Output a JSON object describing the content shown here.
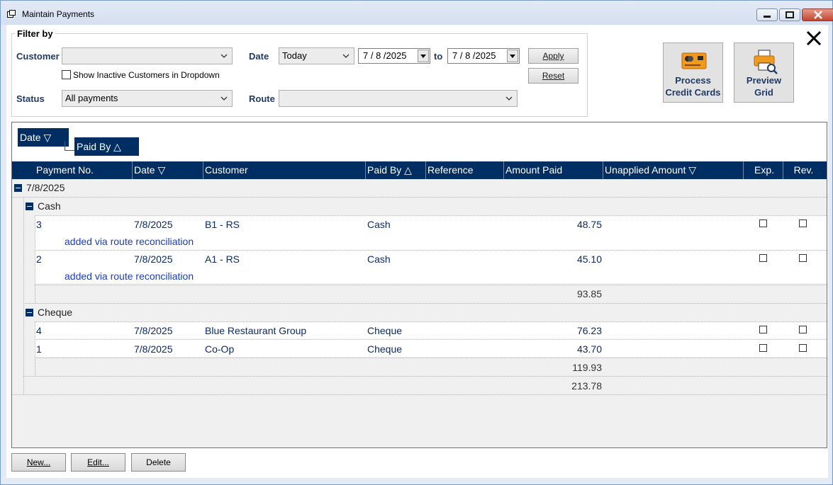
{
  "window": {
    "title": "Maintain Payments"
  },
  "filter": {
    "title": "Filter by",
    "customer_label": "Customer",
    "customer_value": "",
    "show_inactive_label": "Show Inactive Customers in Dropdown",
    "status_label": "Status",
    "status_value": "All payments",
    "date_label": "Date",
    "date_preset": "Today",
    "date_from": "7 / 8 /2025",
    "to_label": "to",
    "date_to": "7 / 8 /2025",
    "route_label": "Route",
    "route_value": "",
    "apply_label": "Apply",
    "reset_label": "Reset"
  },
  "actions": {
    "process_cc_line1": "Process",
    "process_cc_line2": "Credit Cards",
    "preview_line1": "Preview",
    "preview_line2": "Grid"
  },
  "group_by": {
    "chip1": "Date ▽",
    "chip2": "Paid By △"
  },
  "columns": {
    "payment_no": "Payment No.",
    "date": "Date ▽",
    "customer": "Customer",
    "paid_by": "Paid By △",
    "reference": "Reference",
    "amount_paid": "Amount Paid",
    "unapplied": "Unapplied Amount ▽",
    "exp": "Exp.",
    "rev": "Rev."
  },
  "groups": {
    "date_group": "7/8/2025",
    "cash_group": "Cash",
    "cheque_group": "Cheque",
    "cash_total": "93.85",
    "cheque_total": "119.93",
    "date_total": "213.78"
  },
  "rows": [
    {
      "no": "3",
      "date": "7/8/2025",
      "customer": "B1 - RS",
      "paid_by": "Cash",
      "amount": "48.75",
      "note": "added via route reconciliation"
    },
    {
      "no": "2",
      "date": "7/8/2025",
      "customer": "A1 - RS",
      "paid_by": "Cash",
      "amount": "45.10",
      "note": "added via route reconciliation"
    },
    {
      "no": "4",
      "date": "7/8/2025",
      "customer": "Blue Restaurant Group",
      "paid_by": "Cheque",
      "amount": "76.23"
    },
    {
      "no": "1",
      "date": "7/8/2025",
      "customer": "Co-Op",
      "paid_by": "Cheque",
      "amount": "43.70"
    }
  ],
  "buttons": {
    "new_label": "New...",
    "edit_label": "Edit...",
    "delete_label": "Delete"
  }
}
